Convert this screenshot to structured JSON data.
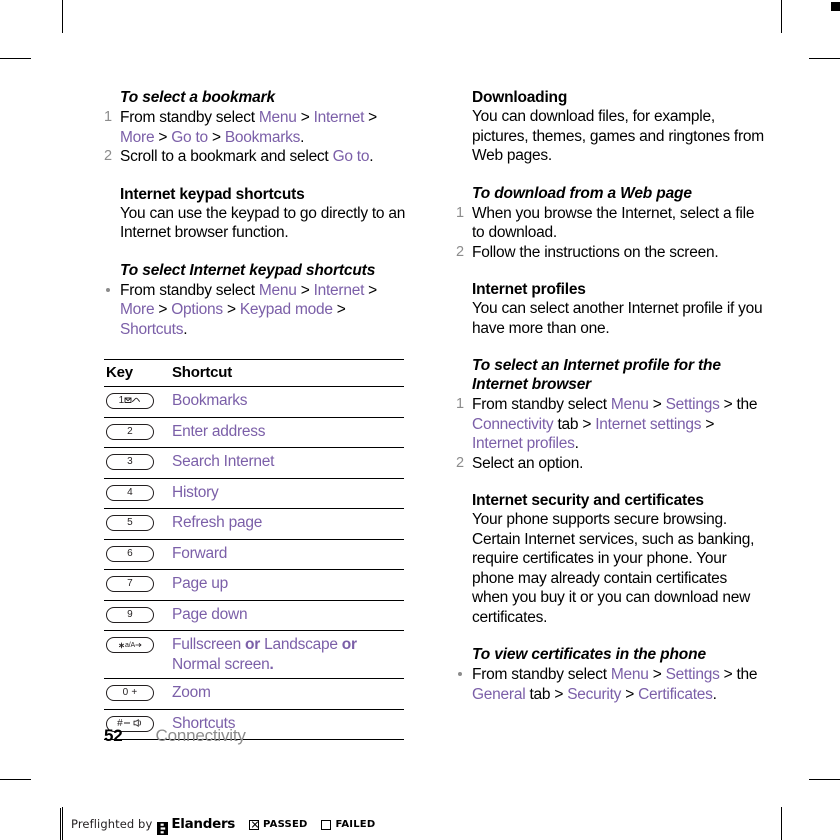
{
  "document": {
    "page_number": "52",
    "chapter": "Connectivity"
  },
  "left_column": {
    "task_bookmark": {
      "heading": "To select a bookmark",
      "steps": [
        {
          "num": "1",
          "parts": [
            {
              "t": "From standby select ",
              "s": "plain"
            },
            {
              "t": "Menu",
              "s": "link"
            },
            {
              "t": " > ",
              "s": "plain"
            },
            {
              "t": "Internet",
              "s": "link"
            },
            {
              "t": " > ",
              "s": "plain"
            },
            {
              "t": "More",
              "s": "link"
            },
            {
              "t": " > ",
              "s": "plain"
            },
            {
              "t": "Go to",
              "s": "link"
            },
            {
              "t": " > ",
              "s": "plain"
            },
            {
              "t": "Bookmarks",
              "s": "link"
            },
            {
              "t": ".",
              "s": "plain"
            }
          ]
        },
        {
          "num": "2",
          "parts": [
            {
              "t": "Scroll to a bookmark and select ",
              "s": "plain"
            },
            {
              "t": "Go to",
              "s": "link"
            },
            {
              "t": ".",
              "s": "plain"
            }
          ]
        }
      ]
    },
    "keypad_shortcuts": {
      "heading": "Internet keypad shortcuts",
      "body": "You can use the keypad to go directly to an Internet browser function."
    },
    "task_keypad": {
      "heading": "To select Internet keypad shortcuts",
      "steps": [
        {
          "bullet": true,
          "parts": [
            {
              "t": "From standby select ",
              "s": "plain"
            },
            {
              "t": "Menu",
              "s": "link"
            },
            {
              "t": " > ",
              "s": "plain"
            },
            {
              "t": "Internet",
              "s": "link"
            },
            {
              "t": " > ",
              "s": "plain"
            },
            {
              "t": "More",
              "s": "link"
            },
            {
              "t": " > ",
              "s": "plain"
            },
            {
              "t": "Options",
              "s": "link"
            },
            {
              "t": " > ",
              "s": "plain"
            },
            {
              "t": "Keypad mode",
              "s": "link"
            },
            {
              "t": " > ",
              "s": "plain"
            },
            {
              "t": "Shortcuts",
              "s": "link"
            },
            {
              "t": ".",
              "s": "plain"
            }
          ]
        }
      ]
    },
    "key_table": {
      "columns": [
        "Key",
        "Shortcut"
      ],
      "rows": [
        {
          "key_label": "1",
          "key_icon": "voicemail-envelope-icon",
          "shortcut": "Bookmarks"
        },
        {
          "key_label": "2",
          "key_icon": "",
          "shortcut": "Enter address"
        },
        {
          "key_label": "3",
          "key_icon": "",
          "shortcut": "Search Internet"
        },
        {
          "key_label": "4",
          "key_icon": "",
          "shortcut": "History"
        },
        {
          "key_label": "5",
          "key_icon": "",
          "shortcut": "Refresh page"
        },
        {
          "key_label": "6",
          "key_icon": "",
          "shortcut": "Forward"
        },
        {
          "key_label": "7",
          "key_icon": "",
          "shortcut": "Page up"
        },
        {
          "key_label": "9",
          "key_icon": "",
          "shortcut": "Page down"
        },
        {
          "key_label": "*a/A",
          "key_icon": "star-key-icon",
          "shortcut": "Fullscreen or Landscape or Normal screen."
        },
        {
          "key_label": "0 +",
          "key_icon": "",
          "shortcut": "Zoom"
        },
        {
          "key_label": "#",
          "key_icon": "silence-key-icon",
          "shortcut": "Shortcuts"
        }
      ],
      "row_fullscreen_parts": [
        {
          "t": "Fullscreen",
          "s": "link"
        },
        {
          "t": " or ",
          "s": "boldblack"
        },
        {
          "t": "Landscape",
          "s": "link"
        },
        {
          "t": " or",
          "s": "boldblack"
        },
        {
          "t": " ",
          "s": "plain"
        },
        {
          "t": "Normal screen",
          "s": "link"
        },
        {
          "t": ".",
          "s": "boldblack"
        }
      ]
    }
  },
  "right_column": {
    "downloading": {
      "heading": "Downloading",
      "body": "You can download files, for example, pictures, themes, games and ringtones from Web pages."
    },
    "task_download": {
      "heading": "To download from a Web page",
      "steps": [
        {
          "num": "1",
          "parts": [
            {
              "t": "When you browse the Internet, select a file to download.",
              "s": "plain"
            }
          ]
        },
        {
          "num": "2",
          "parts": [
            {
              "t": "Follow the instructions on the screen.",
              "s": "plain"
            }
          ]
        }
      ]
    },
    "internet_profiles": {
      "heading": "Internet profiles",
      "body": "You can select another Internet profile if you have more than one."
    },
    "task_profile": {
      "heading": "To select an Internet profile for the Internet browser",
      "steps": [
        {
          "num": "1",
          "parts": [
            {
              "t": "From standby select ",
              "s": "plain"
            },
            {
              "t": "Menu",
              "s": "link"
            },
            {
              "t": " > ",
              "s": "plain"
            },
            {
              "t": "Settings",
              "s": "link"
            },
            {
              "t": " > the ",
              "s": "plain"
            },
            {
              "t": "Connectivity",
              "s": "link"
            },
            {
              "t": " tab > ",
              "s": "plain"
            },
            {
              "t": "Internet settings",
              "s": "link"
            },
            {
              "t": " > ",
              "s": "plain"
            },
            {
              "t": "Internet profiles",
              "s": "link"
            },
            {
              "t": ".",
              "s": "plain"
            }
          ]
        },
        {
          "num": "2",
          "parts": [
            {
              "t": "Select an option.",
              "s": "plain"
            }
          ]
        }
      ]
    },
    "security": {
      "heading": "Internet security and certificates",
      "body": "Your phone supports secure browsing. Certain Internet services, such as banking, require certificates in your phone. Your phone may already contain certificates when you buy it or you can download new certificates."
    },
    "task_certificates": {
      "heading": "To view certificates in the phone",
      "steps": [
        {
          "bullet": true,
          "parts": [
            {
              "t": "From standby select ",
              "s": "plain"
            },
            {
              "t": "Menu",
              "s": "link"
            },
            {
              "t": " > ",
              "s": "plain"
            },
            {
              "t": "Settings",
              "s": "link"
            },
            {
              "t": " > the ",
              "s": "plain"
            },
            {
              "t": "General",
              "s": "link"
            },
            {
              "t": " tab > ",
              "s": "plain"
            },
            {
              "t": "Security",
              "s": "link"
            },
            {
              "t": " > ",
              "s": "plain"
            },
            {
              "t": "Certificates",
              "s": "link"
            },
            {
              "t": ".",
              "s": "plain"
            }
          ]
        }
      ]
    }
  },
  "preflight_bar": {
    "label": "Preflighted by",
    "brand": "Elanders",
    "passed_label": "PASSED",
    "failed_label": "FAILED",
    "passed_checked": true,
    "failed_checked": false
  },
  "colors": {
    "link_purple": "#7b5fa8",
    "step_number_gray": "#8c8c8c",
    "chapter_gray": "#8c8c8c",
    "ink_black": "#000000"
  }
}
